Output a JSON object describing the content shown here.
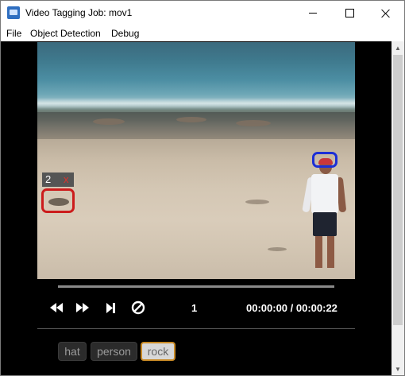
{
  "window": {
    "title": "Video Tagging Job: mov1",
    "icons": {
      "app": "video-tagging-app-icon",
      "minimize": "minimize-icon",
      "maximize": "maximize-icon",
      "close": "close-icon"
    }
  },
  "menubar": {
    "items": [
      "File",
      "Object Detection",
      "Debug"
    ]
  },
  "video": {
    "region_tag": {
      "id": "2",
      "delete": "x",
      "color": "#e0302a"
    },
    "bbox_colors": {
      "rock": "#cc1c1c",
      "hat": "#1c2fd6"
    }
  },
  "playback": {
    "frame": "1",
    "time": "00:00:00 / 00:00:22",
    "icons": [
      "rewind-icon",
      "fast-forward-icon",
      "next-frame-icon",
      "clear-icon"
    ]
  },
  "tags": [
    {
      "label": "hat",
      "selected": false
    },
    {
      "label": "person",
      "selected": false
    },
    {
      "label": "rock",
      "selected": true,
      "highlight_color": "#c98a25"
    }
  ]
}
